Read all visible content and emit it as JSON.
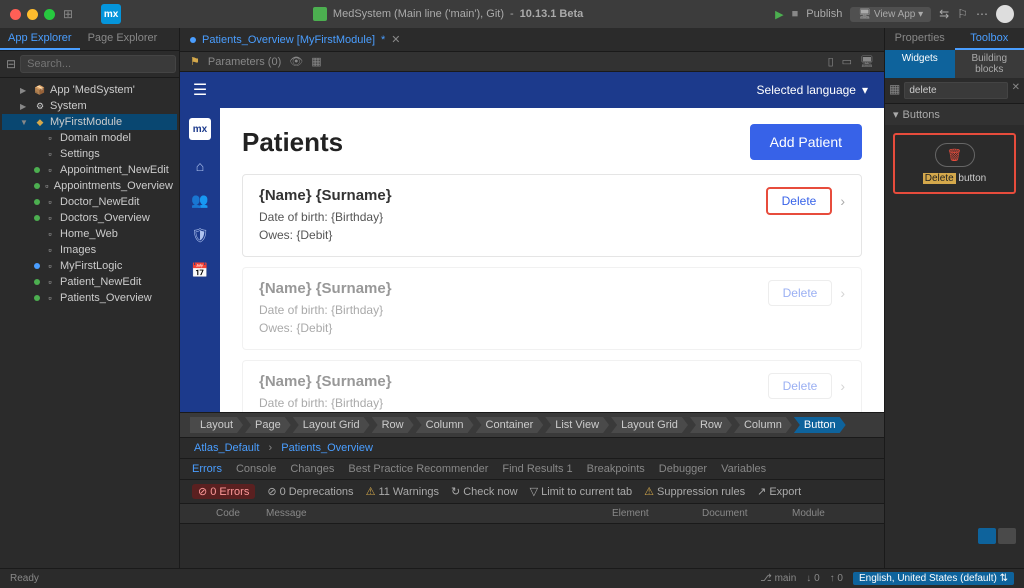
{
  "titlebar": {
    "app_name": "MedSystem (Main line ('main'), Git)",
    "version": "10.13.1 Beta",
    "publish": "Publish",
    "view_app": "View App"
  },
  "left_panel": {
    "tabs": [
      "App Explorer",
      "Page Explorer"
    ],
    "search_placeholder": "Search...",
    "tree": {
      "app": "App 'MedSystem'",
      "system": "System",
      "module": "MyFirstModule",
      "items": [
        {
          "label": "Domain model",
          "status": "none"
        },
        {
          "label": "Settings",
          "status": "none"
        },
        {
          "label": "Appointment_NewEdit",
          "status": "green"
        },
        {
          "label": "Appointments_Overview",
          "status": "green"
        },
        {
          "label": "Doctor_NewEdit",
          "status": "green"
        },
        {
          "label": "Doctors_Overview",
          "status": "green"
        },
        {
          "label": "Home_Web",
          "status": "none"
        },
        {
          "label": "Images",
          "status": "none"
        },
        {
          "label": "MyFirstLogic",
          "status": "blue"
        },
        {
          "label": "Patient_NewEdit",
          "status": "green"
        },
        {
          "label": "Patients_Overview",
          "status": "green"
        }
      ]
    }
  },
  "center": {
    "file_tab": "Patients_Overview [MyFirstModule]",
    "params": "Parameters (0)",
    "preview": {
      "selected_lang": "Selected language",
      "page_title": "Patients",
      "add_button": "Add Patient",
      "card_name": "{Name} {Surname}",
      "card_dob": "Date of birth: {Birthday}",
      "card_owes": "Owes: {Debit}",
      "delete": "Delete"
    },
    "breadcrumbs": [
      "Layout",
      "Page",
      "Layout Grid",
      "Row",
      "Column",
      "Container",
      "List View",
      "Layout Grid",
      "Row",
      "Column",
      "Button"
    ],
    "path": {
      "layout": "Atlas_Default",
      "page": "Patients_Overview"
    }
  },
  "bottom": {
    "tabs": [
      "Errors",
      "Console",
      "Changes",
      "Best Practice Recommender",
      "Find Results 1",
      "Breakpoints",
      "Debugger",
      "Variables"
    ],
    "toolbar": {
      "errors": "0 Errors",
      "deprecations": "0 Deprecations",
      "warnings": "11 Warnings",
      "check": "Check now",
      "limit": "Limit to current tab",
      "suppression": "Suppression rules",
      "export": "Export"
    },
    "columns": {
      "code": "Code",
      "message": "Message",
      "element": "Element",
      "document": "Document",
      "module": "Module"
    }
  },
  "right_panel": {
    "tabs": [
      "Properties",
      "Toolbox"
    ],
    "modes": [
      "Widgets",
      "Building blocks"
    ],
    "search_value": "delete",
    "category": "Buttons",
    "widget": {
      "highlight": "Delete",
      "suffix": " button"
    }
  },
  "statusbar": {
    "ready": "Ready",
    "branch": "main",
    "down": "0",
    "up": "0",
    "language": "English, United States (default)"
  }
}
